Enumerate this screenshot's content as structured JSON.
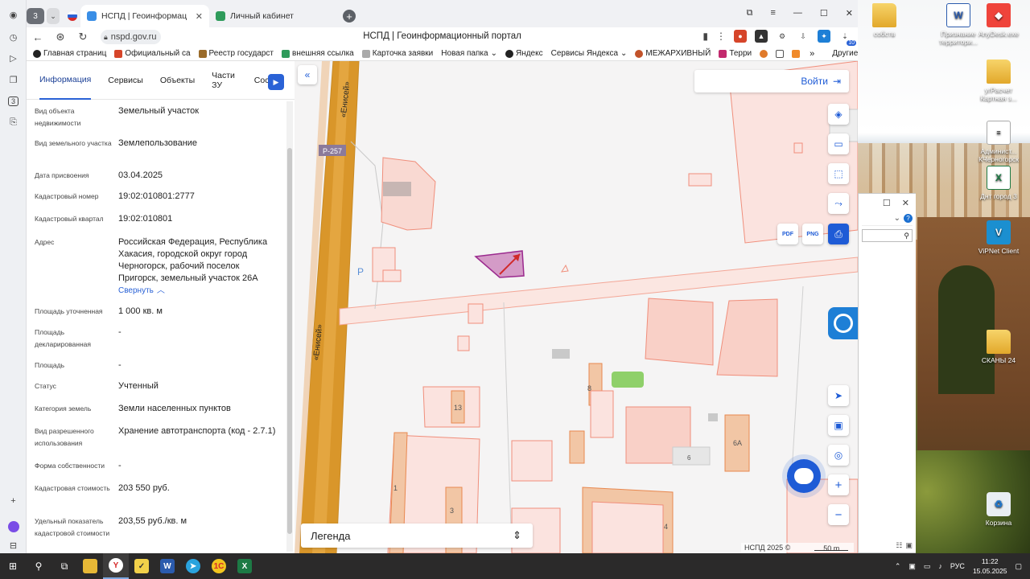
{
  "browser": {
    "tab_group_count": "3",
    "tabs": [
      {
        "title": "НСПД | Геоинформац",
        "active": true
      },
      {
        "title": "Личный кабинет",
        "active": false
      }
    ],
    "url": "nspd.gov.ru",
    "page_title": "НСПД | Геоинформационный портал",
    "extension_badge": "10",
    "bookmarks": [
      "Главная страниц",
      "Официальный са",
      "Реестр государст",
      "внешняя ссылка",
      "Карточка заявки",
      "Новая папка",
      "Яндекс",
      "Сервисы Яндекса",
      "МЕЖАРХИВНЫЙ",
      "Терри"
    ],
    "bookmarks_more": "»",
    "other_bookmarks": "Другие закладки"
  },
  "side_rail": {
    "group_badge": "3"
  },
  "panel": {
    "tabs": [
      "Информация",
      "Сервисы",
      "Объекты",
      "Части ЗУ",
      "Соста"
    ],
    "fields": [
      {
        "label": "Вид объекта недвижимости",
        "value": "Земельный участок"
      },
      {
        "label": "Вид земельного участка",
        "value": "Землепользование"
      },
      {
        "label": "Дата присвоения",
        "value": "03.04.2025"
      },
      {
        "label": "Кадастровый номер",
        "value": "19:02:010801:2777"
      },
      {
        "label": "Кадастровый квартал",
        "value": "19:02:010801"
      },
      {
        "label": "Адрес",
        "value": "Российская Федерация, Республика Хакасия, городской округ город Черногорск, рабочий поселок Пригорск, земельный участок 26А"
      },
      {
        "label": "Площадь уточненная",
        "value": "1 000 кв. м"
      },
      {
        "label": "Площадь декларированная",
        "value": "-"
      },
      {
        "label": "Площадь",
        "value": "-"
      },
      {
        "label": "Статус",
        "value": "Учтенный"
      },
      {
        "label": "Категория земель",
        "value": "Земли населенных пунктов"
      },
      {
        "label": "Вид разрешенного использования",
        "value": "Хранение автотранспорта (код - 2.7.1)"
      },
      {
        "label": "Форма собственности",
        "value": "-"
      },
      {
        "label": "Кадастровая стоимость",
        "value": "203 550 руб."
      },
      {
        "label": "Удельный показатель кадастровой стоимости",
        "value": "203,55 руб./кв. м"
      }
    ],
    "collapse_label": "Свернуть"
  },
  "map": {
    "login_label": "Войти",
    "legend_label": "Легенда",
    "road_name": "«Енисей»",
    "road_code": "Р-257",
    "house_numbers": [
      "13",
      "8",
      "6",
      "6А",
      "1",
      "3",
      "4"
    ],
    "map_letter": "Р",
    "copyright": "НСПД 2025 ©",
    "scale": "50 m",
    "export_pdf": "PDF",
    "export_png": "PNG"
  },
  "desktop": {
    "icons": [
      {
        "label": "собств",
        "type": "folder"
      },
      {
        "label": "Признание территори...",
        "type": "word"
      },
      {
        "label": "AnyDesk.exe",
        "type": "anydesk"
      },
      {
        "label": "угРасчет Картная з...",
        "type": "doc"
      },
      {
        "label": "Админист... КЧерногорск",
        "type": "doc"
      },
      {
        "label": "Днт город 3",
        "type": "excel"
      },
      {
        "label": "ViPNet Client",
        "type": "vipnet"
      },
      {
        "label": "СКАНЫ 24",
        "type": "folder"
      },
      {
        "label": "Корзина",
        "type": "bin"
      }
    ]
  },
  "taskbar": {
    "lang": "РУС",
    "time": "11:22",
    "date": "15.05.2025"
  }
}
